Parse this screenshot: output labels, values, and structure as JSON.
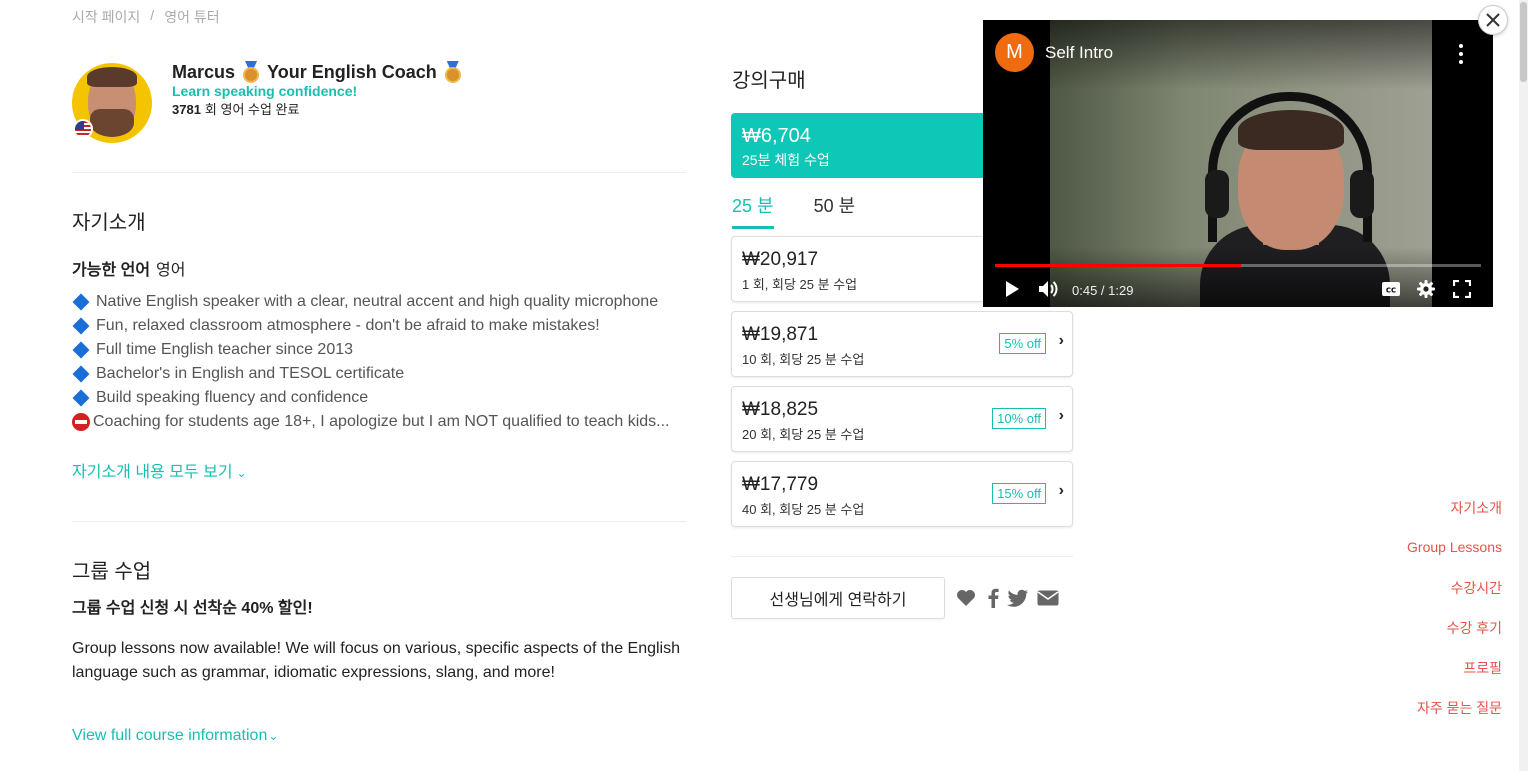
{
  "breadcrumb": {
    "home": "시작 페이지",
    "sep": "/",
    "current": "영어 튜터"
  },
  "tutor": {
    "name": "Marcus",
    "headline": "Your English Coach",
    "tagline": "Learn speaking confidence!",
    "lesson_count": "3781",
    "lesson_count_label": "회 영어 수업 완료",
    "country_flag": "us-flag-icon"
  },
  "intro": {
    "title": "자기소개",
    "languages_label": "가능한 언어",
    "languages_value": "영어",
    "items": [
      {
        "icon": "blue-diamond-icon",
        "text": "Native English speaker with a clear, neutral accent and high quality microphone"
      },
      {
        "icon": "blue-diamond-icon",
        "text": "Fun, relaxed classroom atmosphere - don't be afraid to make mistakes!"
      },
      {
        "icon": "blue-diamond-icon",
        "text": "Full time English teacher since 2013"
      },
      {
        "icon": "blue-diamond-icon",
        "text": "Bachelor's in English and TESOL certificate"
      },
      {
        "icon": "blue-diamond-icon",
        "text": "Build speaking fluency and confidence"
      },
      {
        "icon": "no-entry-icon",
        "text": "Coaching for students age 18+, I apologize but I am NOT qualified to teach kids..."
      }
    ],
    "see_all": "자기소개 내용 모두 보기"
  },
  "group": {
    "title": "그룹 수업",
    "lead": "그룹 수업 신청 시 선착순 40% 할인!",
    "desc": "Group lessons now available! We will focus on various, specific aspects of the English language such as grammar, idiomatic expressions, slang, and more!",
    "link": "View full course information"
  },
  "purchase": {
    "title": "강의구매",
    "trial": {
      "price": "₩6,704",
      "label": "25분 체험 수업"
    },
    "tabs": [
      {
        "label": "25 분",
        "active": true
      },
      {
        "label": "50 분",
        "active": false
      }
    ],
    "packages": [
      {
        "price": "₩20,917",
        "label": "1 회, 회당 25 분 수업",
        "discount": ""
      },
      {
        "price": "₩19,871",
        "label": "10 회, 회당 25 분 수업",
        "discount": "5% off"
      },
      {
        "price": "₩18,825",
        "label": "20 회, 회당 25 분 수업",
        "discount": "10% off"
      },
      {
        "price": "₩17,779",
        "label": "40 회, 회당 25 분 수업",
        "discount": "15% off"
      }
    ],
    "contact": "선생님에게 연락하기"
  },
  "side_nav": [
    "자기소개",
    "Group Lessons",
    "수강시간",
    "수강 후기",
    "프로필",
    "자주 묻는 질문"
  ],
  "video": {
    "channel_initial": "M",
    "title": "Self Intro",
    "time": "0:45 / 1:29",
    "progress": 0.506
  },
  "colors": {
    "accent": "#17bfb0",
    "nav": "#e8534a",
    "progress": "#ff0000"
  }
}
